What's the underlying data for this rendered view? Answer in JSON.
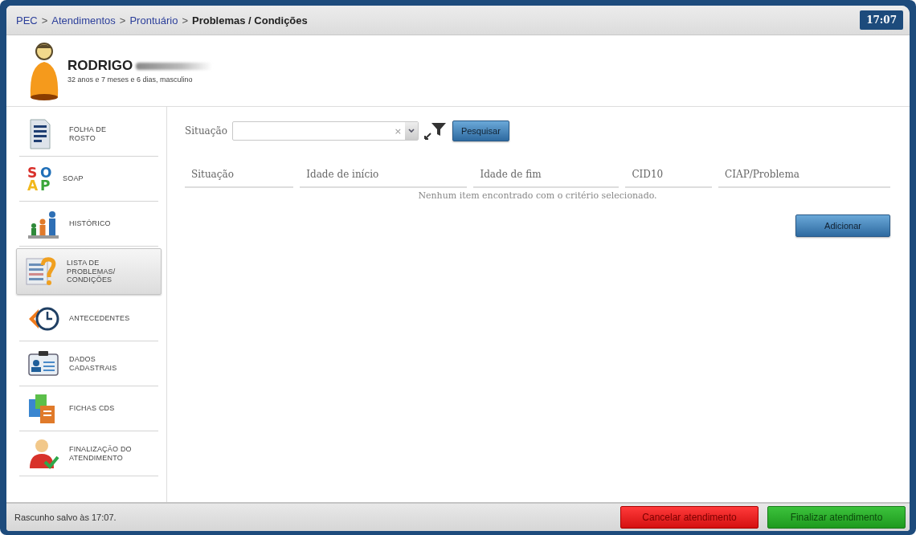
{
  "breadcrumb": [
    {
      "label": "PEC",
      "kind": "link"
    },
    {
      "label": ">",
      "kind": "separator"
    },
    {
      "label": "Atendimentos",
      "kind": "link"
    },
    {
      "label": ">",
      "kind": "separator"
    },
    {
      "label": "Prontuário",
      "kind": "link"
    },
    {
      "label": ">",
      "kind": "separator"
    },
    {
      "label": "Problemas / Condições",
      "kind": "current"
    }
  ],
  "clock": "17:07",
  "patient": {
    "name": "RODRIGO",
    "name_redacted": true,
    "details": "32 anos e 7 meses e 6 dias, masculino"
  },
  "sidebar": {
    "items": [
      {
        "label": "FOLHA DE\nROSTO",
        "selected": false
      },
      {
        "label": "SOAP",
        "selected": false,
        "logo_letters": [
          {
            "text": "S",
            "color": "#d9302b"
          },
          {
            "text": "O",
            "color": "#1f6fb8"
          },
          {
            "text": "A",
            "color": "#f2b81c"
          },
          {
            "text": "P",
            "color": "#3aa63a"
          }
        ]
      },
      {
        "label": "HISTÓRICO",
        "selected": false
      },
      {
        "label": "LISTA DE\nPROBLEMAS/\nCONDIÇÕES",
        "selected": true
      },
      {
        "label": "ANTECEDENTES",
        "selected": false
      },
      {
        "label": "DADOS\nCADASTRAIS",
        "selected": false
      },
      {
        "label": "FICHAS CDS",
        "selected": false
      },
      {
        "label": "FINALIZAÇÃO DO\nATENDIMENTO",
        "selected": false
      }
    ]
  },
  "filter": {
    "label": "Situação",
    "clear_glyph": "×",
    "button": "Pesquisar"
  },
  "table": {
    "columns": [
      "Situação",
      "Idade de início",
      "Idade de fim",
      "CID10",
      "CIAP/Problema"
    ],
    "empty_message": "Nenhum item encontrado com o critério selecionado."
  },
  "add_button": "Adicionar",
  "status_bar": {
    "note": "Rascunho salvo às 17:07.",
    "buttons": [
      {
        "label": "Cancelar atendimento",
        "kind": "danger"
      },
      {
        "label": "Finalizar atendimento",
        "kind": "success"
      }
    ]
  }
}
